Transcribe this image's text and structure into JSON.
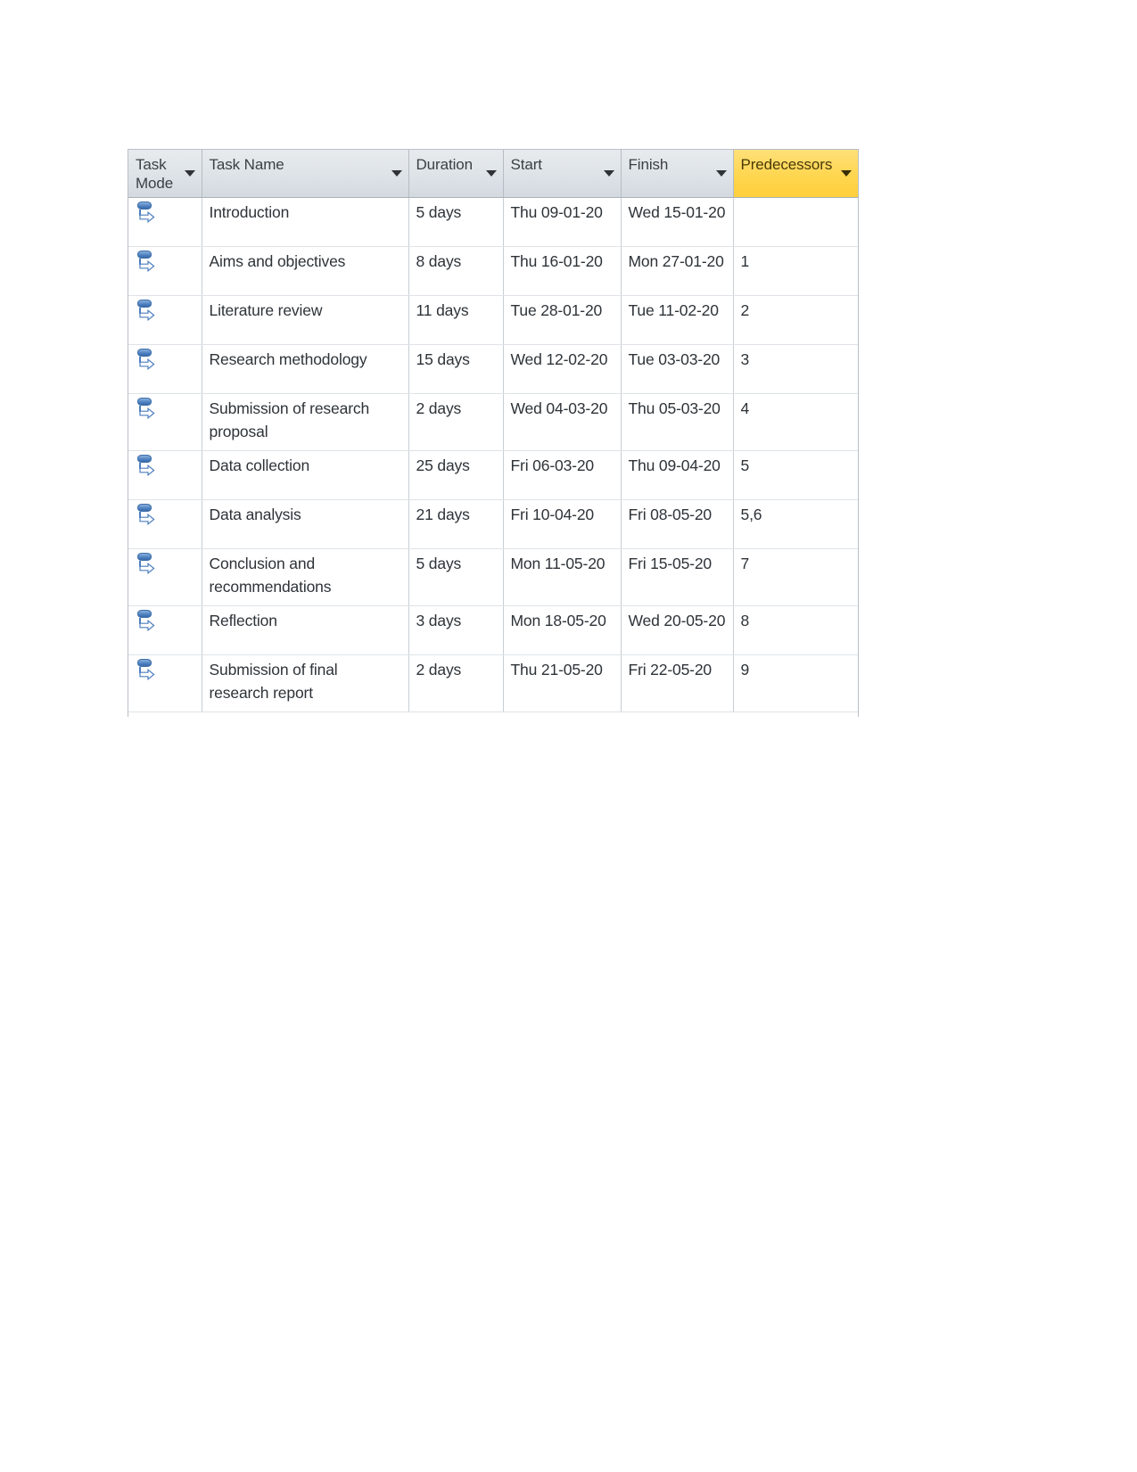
{
  "document": {
    "type": "gantt-task-table",
    "background": "#ffffff"
  },
  "colors": {
    "header_gray": "#dfe4e9",
    "header_amber": "#ffd64f",
    "grid_line": "#c8ced4",
    "text": "#2e3338",
    "icon_blue": "#4d81c2"
  },
  "table": {
    "columns": [
      {
        "key": "task_mode",
        "label": "Task Mode",
        "highlighted": false,
        "icon": "chevron-down-icon"
      },
      {
        "key": "task_name",
        "label": "Task Name",
        "highlighted": false,
        "icon": "chevron-down-icon"
      },
      {
        "key": "duration",
        "label": "Duration",
        "highlighted": false,
        "icon": "chevron-down-icon"
      },
      {
        "key": "start",
        "label": "Start",
        "highlighted": false,
        "icon": "chevron-down-icon"
      },
      {
        "key": "finish",
        "label": "Finish",
        "highlighted": false,
        "icon": "chevron-down-icon"
      },
      {
        "key": "predecessors",
        "label": "Predecessors",
        "highlighted": true,
        "icon": "chevron-down-icon"
      }
    ],
    "rows": [
      {
        "task_mode_icon": "auto-scheduled-icon",
        "task_name": "Introduction",
        "duration": "5 days",
        "start": "Thu 09-01-20",
        "finish": "Wed 15-01-20",
        "predecessors": ""
      },
      {
        "task_mode_icon": "auto-scheduled-icon",
        "task_name": "Aims and objectives",
        "duration": "8 days",
        "start": "Thu 16-01-20",
        "finish": "Mon 27-01-20",
        "predecessors": "1"
      },
      {
        "task_mode_icon": "auto-scheduled-icon",
        "task_name": "Literature review",
        "duration": "11 days",
        "start": "Tue 28-01-20",
        "finish": "Tue 11-02-20",
        "predecessors": "2"
      },
      {
        "task_mode_icon": "auto-scheduled-icon",
        "task_name": "Research methodology",
        "duration": "15 days",
        "start": "Wed 12-02-20",
        "finish": "Tue 03-03-20",
        "predecessors": "3"
      },
      {
        "task_mode_icon": "auto-scheduled-icon",
        "task_name": "Submission of research proposal",
        "duration": "2 days",
        "start": "Wed 04-03-20",
        "finish": "Thu 05-03-20",
        "predecessors": "4"
      },
      {
        "task_mode_icon": "auto-scheduled-icon",
        "task_name": "Data collection",
        "duration": "25 days",
        "start": "Fri 06-03-20",
        "finish": "Thu 09-04-20",
        "predecessors": "5"
      },
      {
        "task_mode_icon": "auto-scheduled-icon",
        "task_name": "Data analysis",
        "duration": "21 days",
        "start": "Fri 10-04-20",
        "finish": "Fri 08-05-20",
        "predecessors": "5,6"
      },
      {
        "task_mode_icon": "auto-scheduled-icon",
        "task_name": "Conclusion and recommendations",
        "duration": "5 days",
        "start": "Mon 11-05-20",
        "finish": "Fri 15-05-20",
        "predecessors": "7"
      },
      {
        "task_mode_icon": "auto-scheduled-icon",
        "task_name": "Reflection",
        "duration": "3 days",
        "start": "Mon 18-05-20",
        "finish": "Wed 20-05-20",
        "predecessors": "8"
      },
      {
        "task_mode_icon": "auto-scheduled-icon",
        "task_name": "Submission of final research report",
        "duration": "2 days",
        "start": "Thu 21-05-20",
        "finish": "Fri 22-05-20",
        "predecessors": "9"
      }
    ]
  }
}
